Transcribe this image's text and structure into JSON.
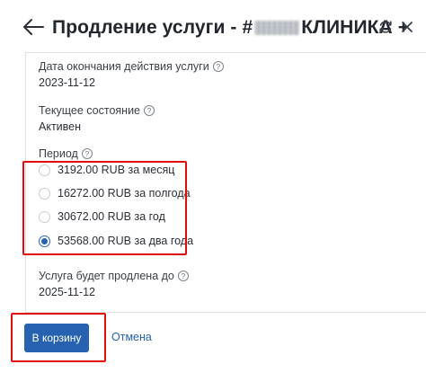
{
  "header": {
    "title_prefix": "Продление услуги - #",
    "title_suffix": "КЛИНИКА +"
  },
  "icons": {
    "back": "arrow-left-icon",
    "refresh": "refresh-icon",
    "close": "close-icon"
  },
  "fields": {
    "end_date": {
      "label": "Дата окончания действия услуги",
      "value": "2023-11-12"
    },
    "status": {
      "label": "Текущее состояние",
      "value": "Активен"
    },
    "period": {
      "label": "Период",
      "options": [
        {
          "label": "3192.00 RUB за месяц",
          "selected": false
        },
        {
          "label": "16272.00 RUB за полгода",
          "selected": false
        },
        {
          "label": "30672.00 RUB за год",
          "selected": false
        },
        {
          "label": "53568.00 RUB за два года",
          "selected": true
        }
      ]
    },
    "extended_until": {
      "label": "Услуга будет продлена до",
      "value": "2025-11-12"
    }
  },
  "actions": {
    "add_to_cart": "В корзину",
    "cancel": "Отмена"
  },
  "colors": {
    "accent": "#2762b0",
    "highlight": "#e10b0b"
  }
}
